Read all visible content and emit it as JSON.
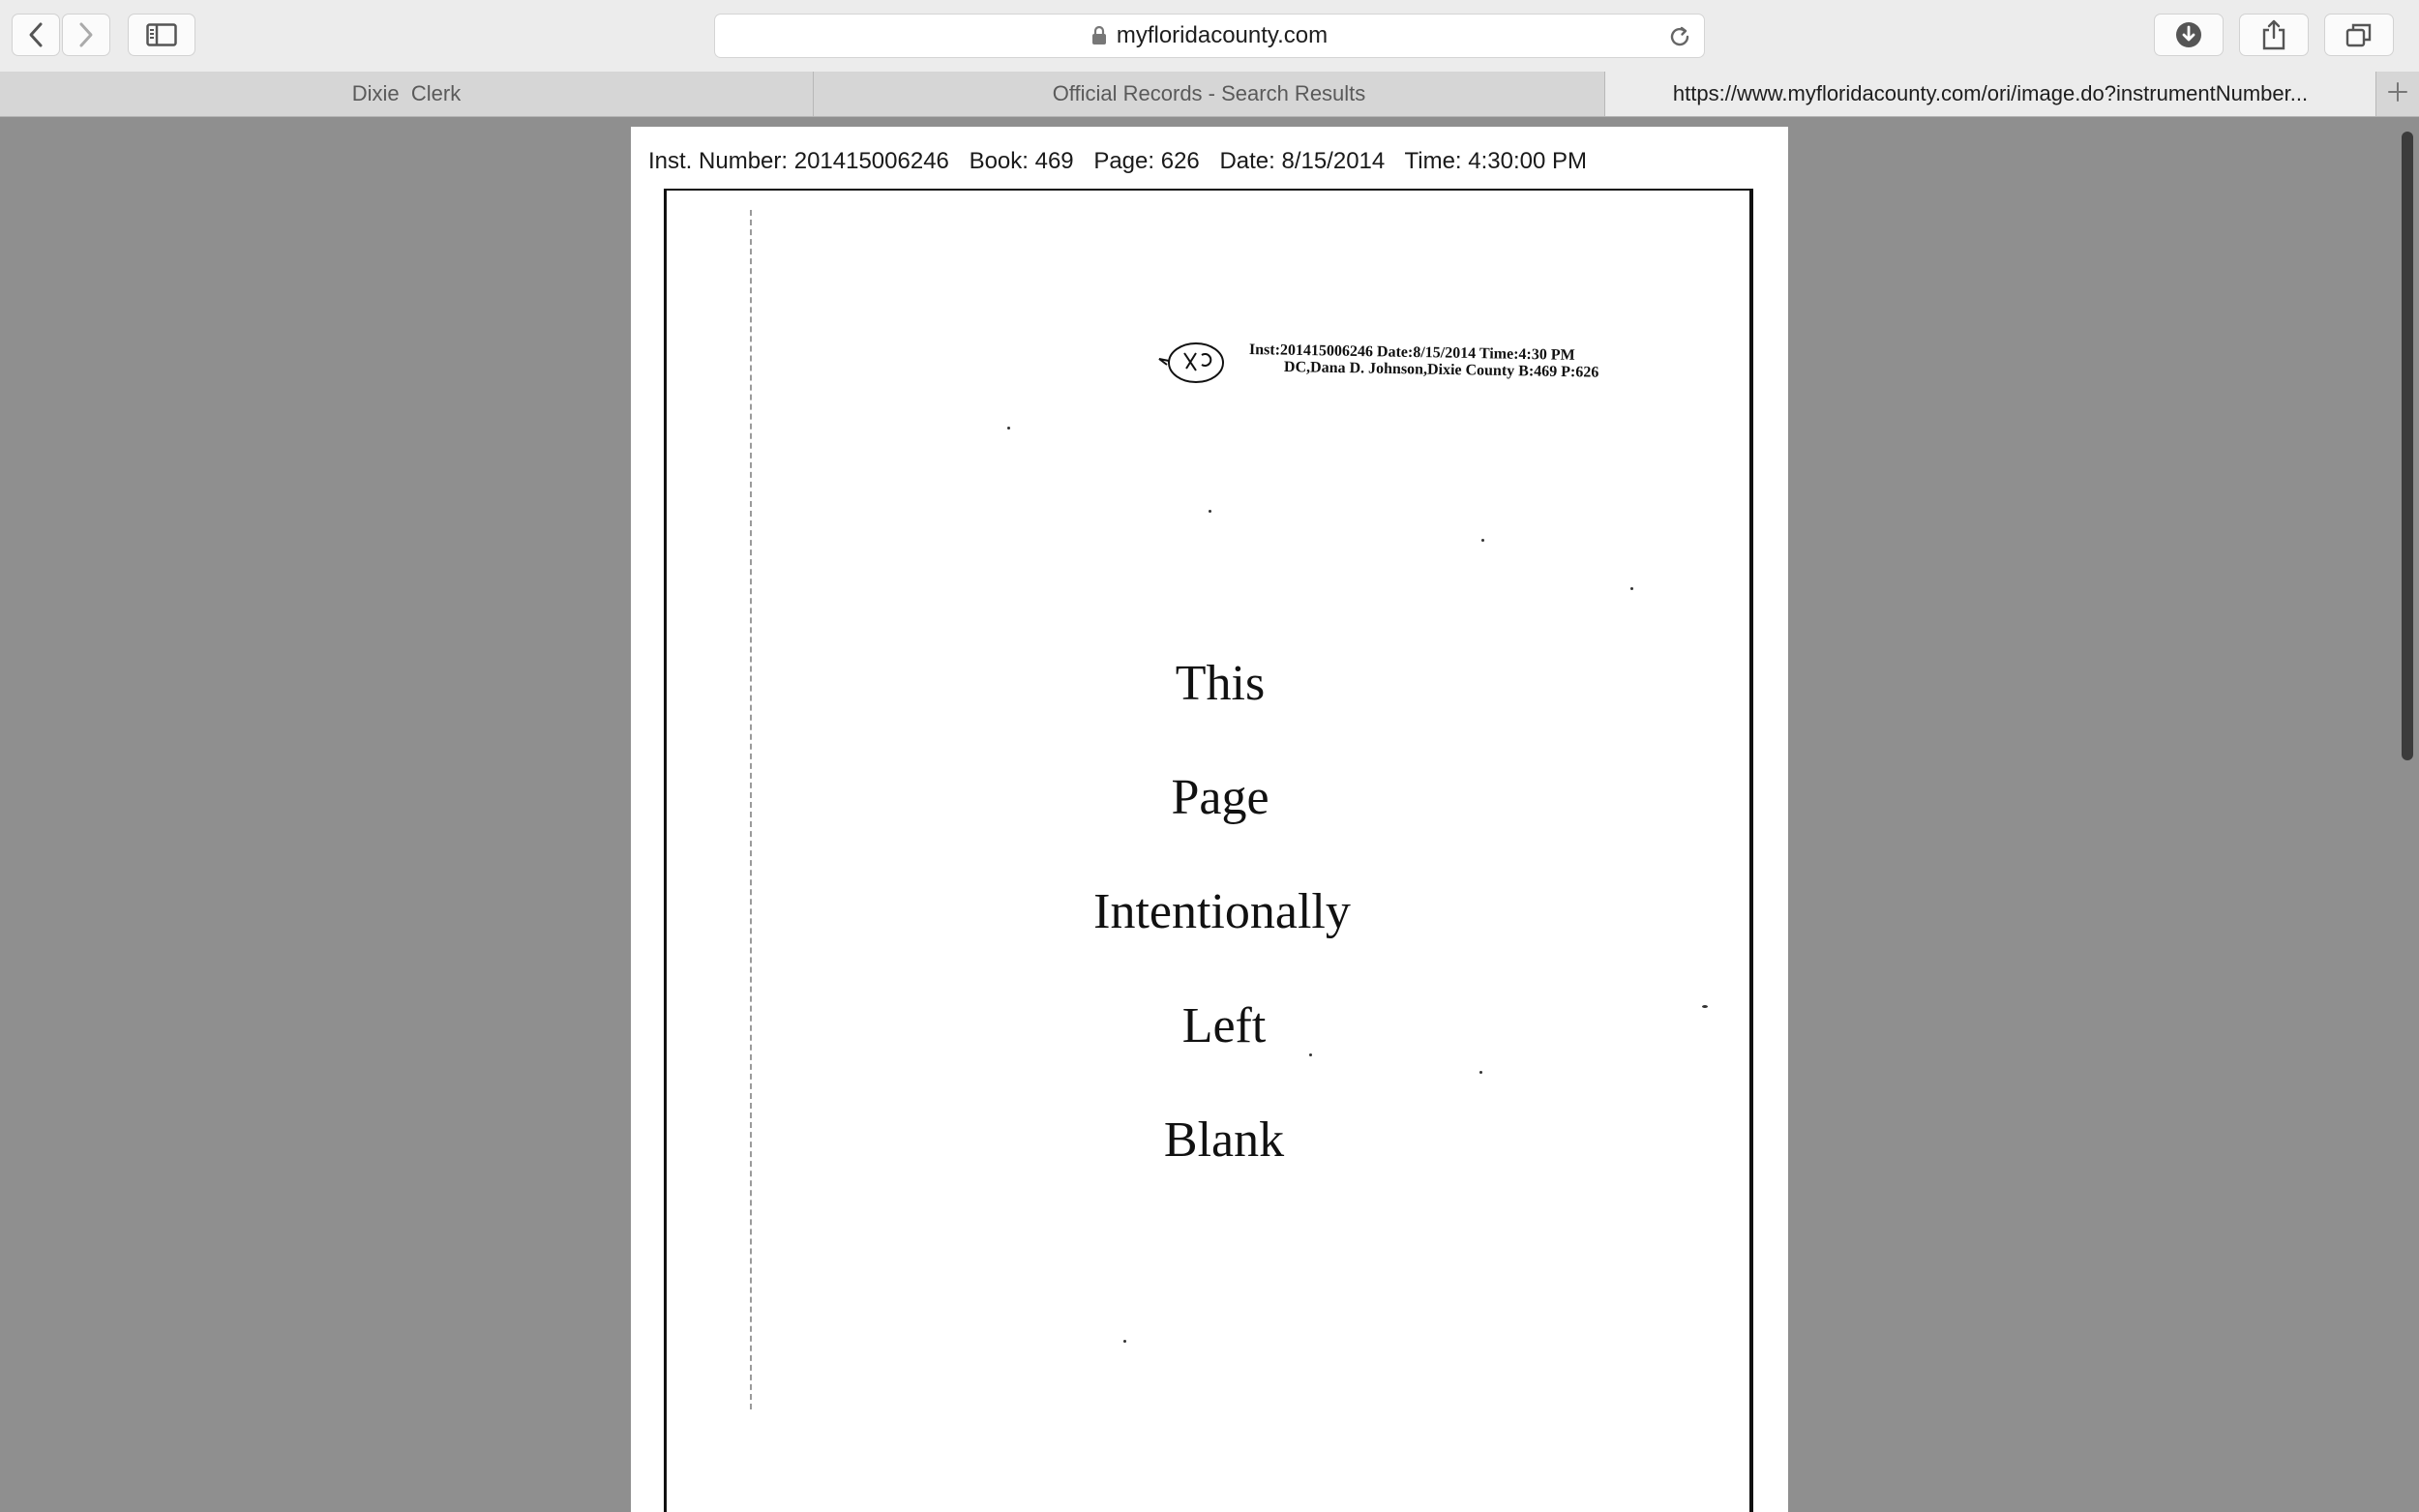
{
  "browser": {
    "address": "myfloridacounty.com",
    "tabs": [
      {
        "label": "Dixie  Clerk",
        "active": false
      },
      {
        "label": "Official Records - Search Results",
        "active": false
      },
      {
        "label": "https://www.myfloridacounty.com/ori/image.do?instrumentNumber...",
        "active": true
      }
    ],
    "icons": {
      "back": "chevron-left-icon",
      "forward": "chevron-right-icon",
      "sidebar": "sidebar-icon",
      "lock": "lock-icon",
      "reload": "reload-icon",
      "downloads": "download-icon",
      "share": "share-icon",
      "tabs": "tab-overview-icon",
      "new_tab": "plus-icon"
    }
  },
  "document": {
    "header": {
      "inst_number": "Inst. Number: 201415006246",
      "book": "Book: 469",
      "page": "Page: 626",
      "date": "Date: 8/15/2014",
      "time": "Time: 4:30:00 PM"
    },
    "stamp": {
      "line1": "Inst:201415006246 Date:8/15/2014 Time:4:30 PM",
      "line2": "DC,Dana D. Johnson,Dixie County B:469 P:626"
    },
    "words": [
      "This",
      "Page",
      "Intentionally",
      "Left",
      "Blank"
    ]
  },
  "colors": {
    "toolbar_bg": "#ececec",
    "viewport_bg": "#8f8f8f",
    "page_bg": "#ffffff"
  }
}
